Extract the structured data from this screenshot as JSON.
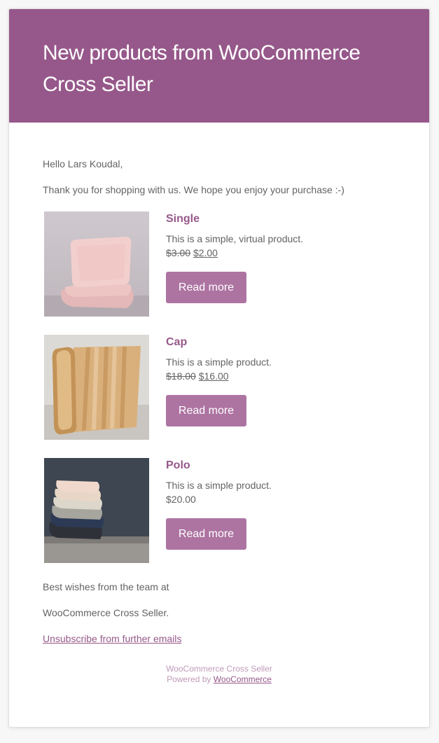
{
  "header": {
    "title_line1": "New products from WooCommerce",
    "title_line2": "Cross Seller"
  },
  "greeting": "Hello Lars Koudal,",
  "intro": "Thank you for shopping with us. We hope you enjoy your purchase :-)",
  "products": [
    {
      "name": "Single",
      "description": "This is a simple, virtual product.",
      "regular_price": "$3.00",
      "sale_price": "$2.00",
      "button": "Read more",
      "image_icon": "pillow-image"
    },
    {
      "name": "Cap",
      "description": "This is a simple product.",
      "regular_price": "$18.00",
      "sale_price": "$16.00",
      "button": "Read more",
      "image_icon": "rug-image"
    },
    {
      "name": "Polo",
      "description": "This is a simple product.",
      "price": "$20.00",
      "button": "Read more",
      "image_icon": "folded-towels-image"
    }
  ],
  "closing": "Best wishes from the team at",
  "team": "WooCommerce Cross Seller.",
  "unsubscribe": "Unsubscribe from further emails",
  "footer": {
    "site": "WooCommerce Cross Seller",
    "powered_by": "Powered by",
    "powered_link": "WooCommerce"
  },
  "colors": {
    "brand": "#96588a",
    "button": "#ad74a2",
    "text": "#636363",
    "background": "#f7f7f7",
    "footer_text": "#c09bb9"
  }
}
